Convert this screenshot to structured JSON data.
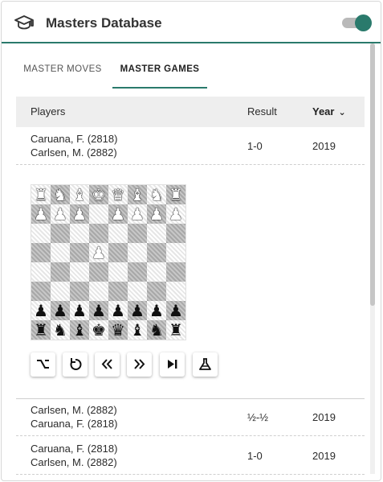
{
  "header": {
    "title": "Masters Database",
    "toggle_on": true,
    "accent": "#2a7a6c"
  },
  "tabs": [
    {
      "label": "MASTER MOVES",
      "active": false
    },
    {
      "label": "MASTER GAMES",
      "active": true
    }
  ],
  "table": {
    "columns": {
      "players": "Players",
      "result": "Result",
      "year": "Year"
    },
    "sort_icon": "chevron-down-icon",
    "games": [
      {
        "white": "Caruana, F. (2818)",
        "black": "Carlsen, M. (2882)",
        "result": "1-0",
        "year": "2019"
      },
      {
        "white": "Carlsen, M. (2882)",
        "black": "Caruana, F. (2818)",
        "result": "½-½",
        "year": "2019"
      },
      {
        "white": "Caruana, F. (2818)",
        "black": "Carlsen, M. (2882)",
        "result": "1-0",
        "year": "2019"
      }
    ]
  },
  "board": {
    "rows": [
      "RNBKQBNR",
      "PPP.PPPP",
      "........",
      "...P....",
      "........",
      "........",
      "pppppppp",
      "rnbkqbnr"
    ]
  },
  "controls": [
    {
      "name": "option-key-button",
      "icon": "option-icon"
    },
    {
      "name": "flip-board-button",
      "icon": "rotate-icon"
    },
    {
      "name": "first-move-button",
      "icon": "double-chevron-left-icon"
    },
    {
      "name": "last-move-button",
      "icon": "double-chevron-right-icon"
    },
    {
      "name": "play-button",
      "icon": "skip-end-icon"
    },
    {
      "name": "analysis-button",
      "icon": "flask-icon"
    }
  ]
}
